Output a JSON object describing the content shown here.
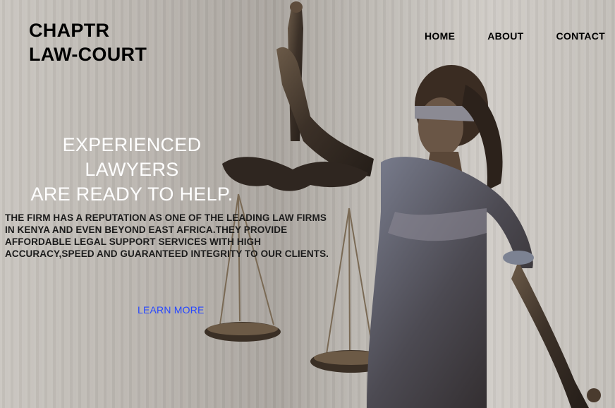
{
  "brand": {
    "line1": "CHAPTR",
    "line2": "LAW-COURT"
  },
  "nav": {
    "home": "HOME",
    "about": "ABOUT",
    "contact": "CONTACT"
  },
  "hero": {
    "headline_line1": "EXPERIENCED LAWYERS",
    "headline_line2": "ARE READY TO HELP.",
    "description": "THE FIRM HAS A REPUTATION AS ONE OF THE LEADING LAW FIRMS IN KENYA AND EVEN BEYOND EAST AFRICA.THEY PROVIDE AFFORDABLE LEGAL SUPPORT SERVICES WITH HIGH ACCURACY,SPEED AND GUARANTEED INTEGRITY TO OUR CLIENTS.",
    "cta": "LEARN MORE"
  },
  "colors": {
    "cta": "#2748ff",
    "headline": "#ffffff",
    "text": "#000000"
  },
  "icons": {
    "hero_image": "lady-justice-statue"
  }
}
